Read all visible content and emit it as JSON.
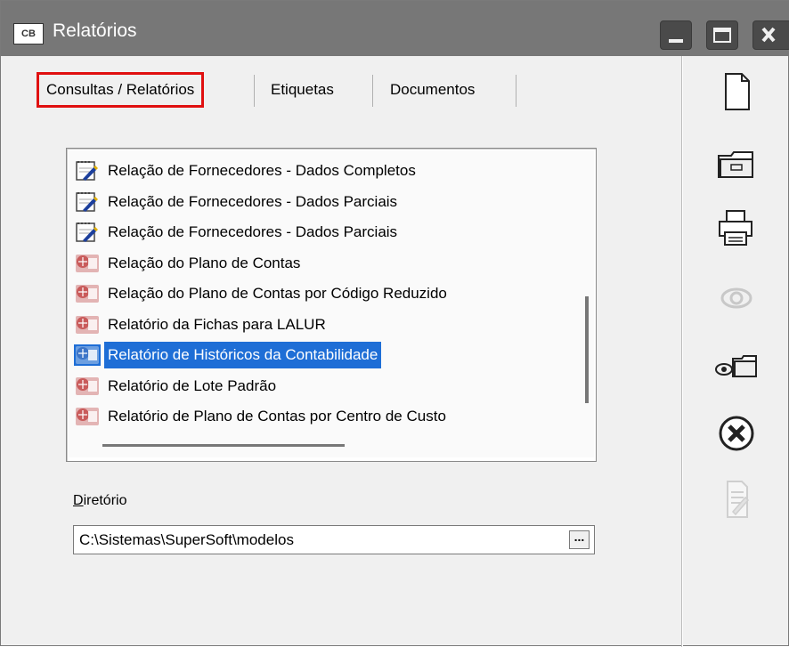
{
  "window": {
    "title": "Relatórios",
    "app_icon_label": "CB",
    "title_buttons": [
      "minimize",
      "maximize",
      "close"
    ]
  },
  "tabs": [
    {
      "label": "Consultas / Relatórios",
      "active": true
    },
    {
      "label": "Etiquetas",
      "active": false
    },
    {
      "label": "Documentos",
      "active": false
    }
  ],
  "report_list": {
    "items": [
      {
        "label": "Relação de Fornecedores - Dados Completos",
        "icon": "notepad-edit-icon",
        "selected": false
      },
      {
        "label": "Relação de Fornecedores - Dados Parciais",
        "icon": "notepad-edit-icon",
        "selected": false
      },
      {
        "label": "Relação de Fornecedores - Dados Parciais",
        "icon": "notepad-edit-icon",
        "selected": false
      },
      {
        "label": "Relação do Plano de  Contas",
        "icon": "report-globe-icon",
        "selected": false
      },
      {
        "label": "Relação do Plano de Contas por Código Reduzido",
        "icon": "report-globe-icon",
        "selected": false
      },
      {
        "label": "Relatório da Fichas para LALUR",
        "icon": "report-globe-icon",
        "selected": false
      },
      {
        "label": "Relatório de Históricos da Contabilidade",
        "icon": "report-globe-icon",
        "selected": true
      },
      {
        "label": "Relatório de Lote Padrão",
        "icon": "report-globe-icon",
        "selected": false
      },
      {
        "label": "Relatório de Plano de Contas por Centro de Custo",
        "icon": "report-globe-icon",
        "selected": false
      }
    ]
  },
  "directory": {
    "label": "Diretório",
    "label_accesskey": "D",
    "label_rest": "iretório",
    "value": "C:\\Sistemas\\SuperSoft\\modelos",
    "browse_label": "..."
  },
  "sidebar": {
    "buttons": [
      {
        "name": "new-document-button",
        "icon": "new-document-icon",
        "enabled": true
      },
      {
        "name": "open-folder-button",
        "icon": "folder-icon",
        "enabled": true
      },
      {
        "name": "print-button",
        "icon": "printer-icon",
        "enabled": true
      },
      {
        "name": "preview-button",
        "icon": "eye-icon",
        "enabled": false
      },
      {
        "name": "preview-folder-button",
        "icon": "eye-folder-icon",
        "enabled": true
      },
      {
        "name": "cancel-button",
        "icon": "close-circle-icon",
        "enabled": true
      },
      {
        "name": "edit-report-button",
        "icon": "edit-document-icon",
        "enabled": false
      }
    ]
  },
  "colors": {
    "titlebar": "#777777",
    "selection": "#1e6ed6",
    "active_tab_border": "#e01010",
    "window_bg": "#f0f0f0"
  }
}
